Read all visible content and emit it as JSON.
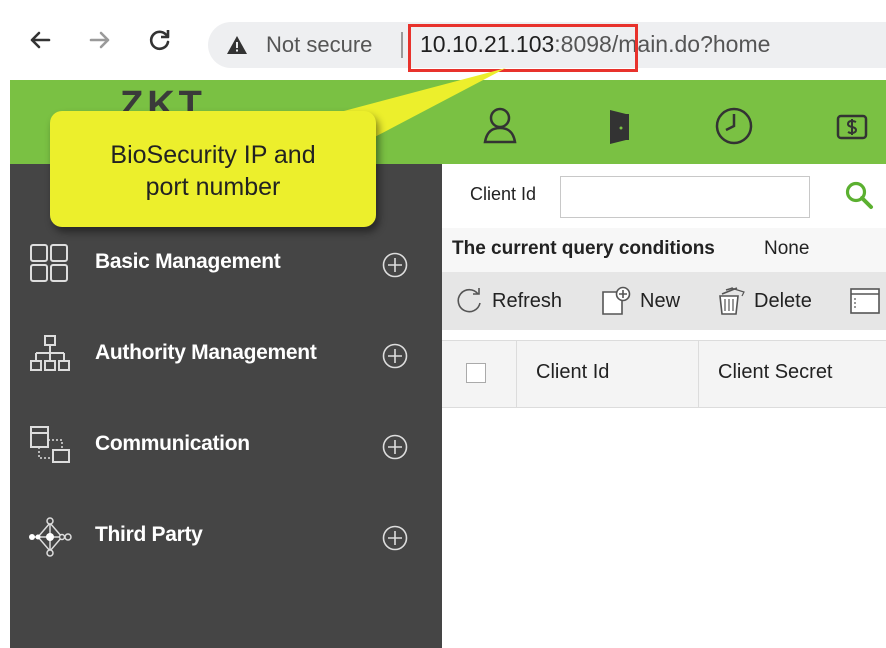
{
  "browser": {
    "security_label": "Not secure",
    "url_host": "10.10.21.103",
    "url_rest": ":8098/main.do?home",
    "icons": [
      "back-arrow-icon",
      "forward-arrow-icon",
      "reload-icon",
      "warning-icon"
    ]
  },
  "header": {
    "logo_text": "ZKT",
    "icons": [
      "person-icon",
      "door-icon",
      "clock-icon",
      "money-icon"
    ],
    "accent_color": "#7ac143"
  },
  "callout": {
    "line1": "BioSecurity IP and",
    "line2": "port number",
    "color": "#ecef2c",
    "highlight_color": "#e8322c"
  },
  "sidebar": {
    "background": "#454545",
    "items": [
      {
        "label": "Basic Management",
        "icon": "grid-icon"
      },
      {
        "label": "Authority Management",
        "icon": "org-chart-icon"
      },
      {
        "label": "Communication",
        "icon": "communication-icon"
      },
      {
        "label": "Third Party",
        "icon": "network-icon"
      }
    ]
  },
  "filter": {
    "label": "Client Id",
    "value": "",
    "placeholder": ""
  },
  "query": {
    "label": "The current query conditions",
    "value": "None"
  },
  "toolbar": {
    "refresh_label": "Refresh",
    "new_label": "New",
    "delete_label": "Delete"
  },
  "table": {
    "columns": [
      "Client Id",
      "Client Secret"
    ]
  }
}
